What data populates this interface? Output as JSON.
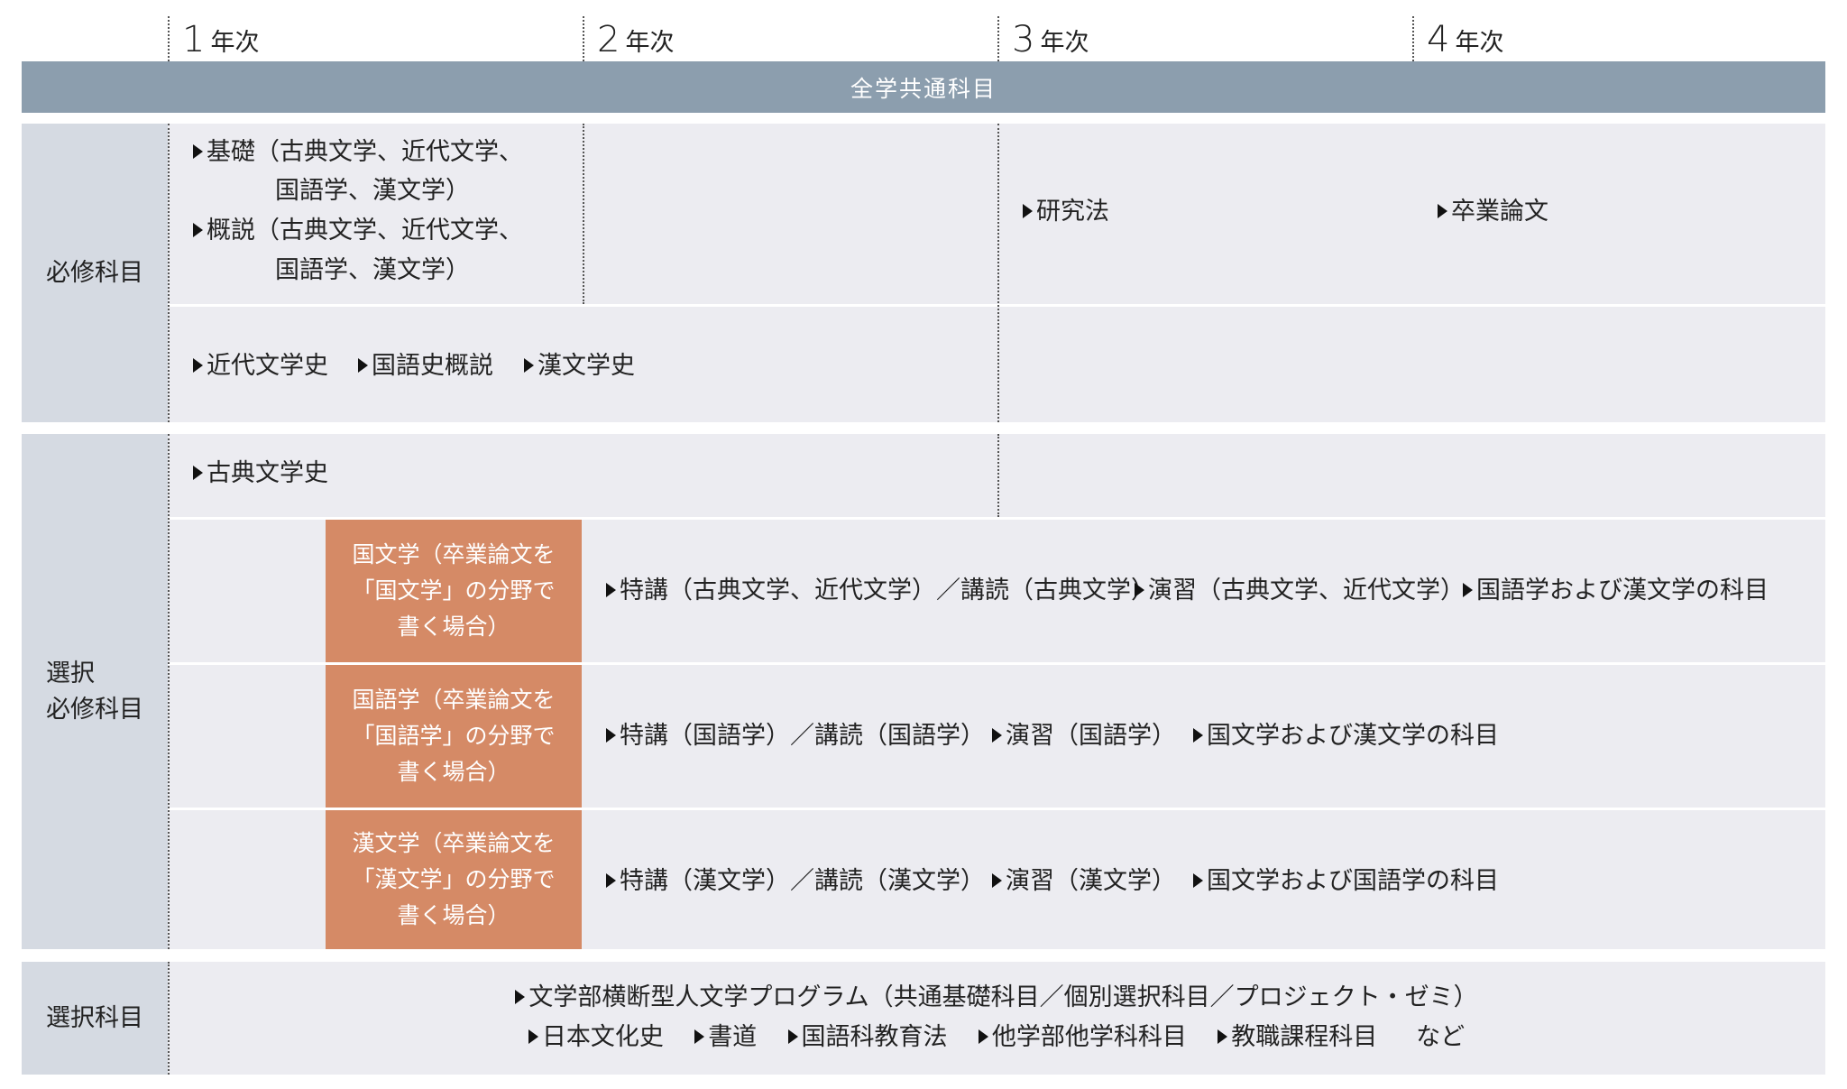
{
  "years": [
    {
      "num": "1",
      "unit": "年次"
    },
    {
      "num": "2",
      "unit": "年次"
    },
    {
      "num": "3",
      "unit": "年次"
    },
    {
      "num": "4",
      "unit": "年次"
    }
  ],
  "common_subjects": "全学共通科目",
  "required": {
    "label": "必修科目",
    "kiso_line1": "基礎（古典文学、近代文学、",
    "kiso_line2": "国語学、漢文学）",
    "gaisetsu_line1": "概説（古典文学、近代文学、",
    "gaisetsu_line2": "国語学、漢文学）",
    "kenkyuho": "研究法",
    "sotsuron": "卒業論文",
    "kindai_bungakushi": "近代文学史",
    "kokugoshi_gaisetsu": "国語史概説",
    "kanbungakushi": "漢文学史"
  },
  "selective_required": {
    "label_line1": "選択",
    "label_line2": "必修科目",
    "koten_bungakushi": "古典文学史",
    "tracks": [
      {
        "box_line1": "国文学（卒業論文を",
        "box_line2": "「国文学」の分野で",
        "box_line3": "書く場合）",
        "items": [
          "特講（古典文学、近代文学）／講読（古典文学）",
          "演習（古典文学、近代文学）",
          "国語学および漢文学の科目"
        ]
      },
      {
        "box_line1": "国語学（卒業論文を",
        "box_line2": "「国語学」の分野で",
        "box_line3": "書く場合）",
        "items": [
          "特講（国語学）／講読（国語学）",
          "演習（国語学）",
          "国文学および漢文学の科目"
        ]
      },
      {
        "box_line1": "漢文学（卒業論文を",
        "box_line2": "「漢文学」の分野で",
        "box_line3": "書く場合）",
        "items": [
          "特講（漢文学）／講読（漢文学）",
          "演習（漢文学）",
          "国文学および国語学の科目"
        ]
      }
    ]
  },
  "elective": {
    "label": "選択科目",
    "line1": "文学部横断型人文学プログラム（共通基礎科目／個別選択科目／プロジェクト・ゼミ）",
    "line2_items": [
      "日本文化史",
      "書道",
      "国語科教育法",
      "他学部他学科科目",
      "教職課程科目"
    ],
    "line2_suffix": "など"
  }
}
